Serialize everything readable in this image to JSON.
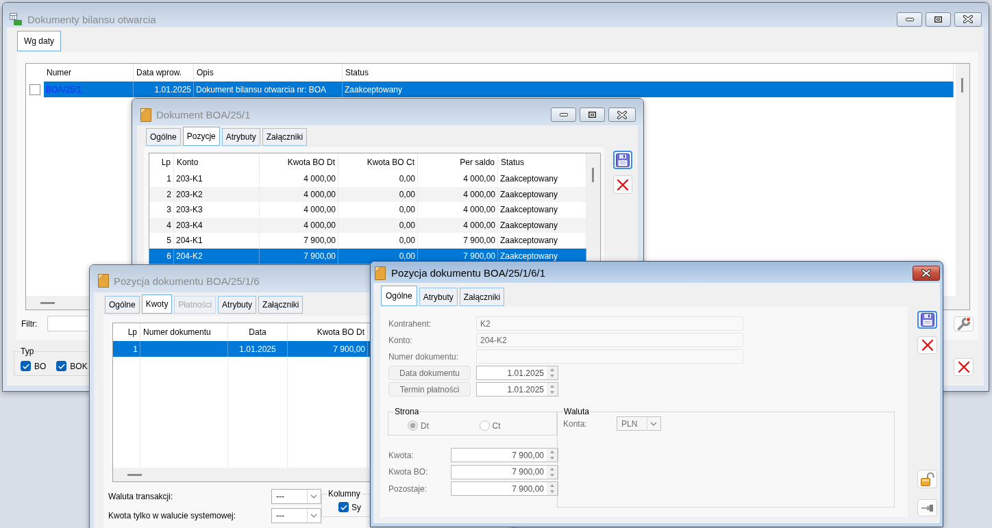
{
  "main_window": {
    "title": "Dokumenty bilansu otwarcia",
    "active": false,
    "tabs": [
      {
        "label": "Wg daty",
        "selected": true
      }
    ],
    "table": {
      "columns": [
        "Numer",
        "Data wprow.",
        "Opis",
        "Status"
      ],
      "rows": [
        {
          "checked": false,
          "selected": true,
          "cells": [
            "BOA/25/1",
            "1.01.2025",
            "Dokument bilansu otwarcia nr: BOA",
            "Zaakceptowany"
          ]
        }
      ]
    },
    "filter": {
      "label": "Filtr:"
    },
    "type_group": {
      "title": "Typ",
      "options": [
        {
          "label": "BO",
          "checked": true
        },
        {
          "label": "BOK",
          "checked": true
        }
      ]
    }
  },
  "document_window": {
    "title": "Dokument BOA/25/1",
    "active": false,
    "tabs": [
      {
        "label": "Ogólne",
        "selected": false
      },
      {
        "label": "Pozycje",
        "selected": true
      },
      {
        "label": "Atrybuty",
        "selected": false
      },
      {
        "label": "Załączniki",
        "selected": false
      }
    ],
    "table": {
      "columns": [
        "Lp",
        "Konto",
        "Kwota BO Dt",
        "Kwota BO Ct",
        "Per saldo",
        "Status"
      ],
      "rows": [
        {
          "selected": false,
          "cells": [
            "1",
            "203-K1",
            "4 000,00",
            "0,00",
            "4 000,00",
            "Zaakceptowany"
          ]
        },
        {
          "selected": false,
          "cells": [
            "2",
            "203-K2",
            "4 000,00",
            "0,00",
            "4 000,00",
            "Zaakceptowany"
          ]
        },
        {
          "selected": false,
          "cells": [
            "3",
            "203-K3",
            "4 000,00",
            "0,00",
            "4 000,00",
            "Zaakceptowany"
          ]
        },
        {
          "selected": false,
          "cells": [
            "4",
            "203-K4",
            "4 000,00",
            "0,00",
            "4 000,00",
            "Zaakceptowany"
          ]
        },
        {
          "selected": false,
          "cells": [
            "5",
            "204-K1",
            "7 900,00",
            "0,00",
            "7 900,00",
            "Zaakceptowany"
          ]
        },
        {
          "selected": true,
          "cells": [
            "6",
            "204-K2",
            "7 900,00",
            "0,00",
            "7 900,00",
            "Zaakceptowany"
          ]
        }
      ]
    }
  },
  "position_window": {
    "title": "Pozycja dokumentu BOA/25/1/6",
    "active": false,
    "tabs": [
      {
        "label": "Ogólne",
        "selected": false,
        "disabled": false
      },
      {
        "label": "Kwoty",
        "selected": true,
        "disabled": false
      },
      {
        "label": "Płatności",
        "selected": false,
        "disabled": true
      },
      {
        "label": "Atrybuty",
        "selected": false,
        "disabled": false
      },
      {
        "label": "Załączniki",
        "selected": false,
        "disabled": false
      }
    ],
    "table": {
      "columns": [
        "Lp",
        "Numer dokumentu",
        "Data",
        "Kwota BO Dt"
      ],
      "rows": [
        {
          "selected": true,
          "lp": "1",
          "date": "1.01.2025",
          "amount_dt": "7 900,00"
        }
      ]
    },
    "selects": [
      {
        "label": "Waluta transakcji:",
        "value": "---"
      },
      {
        "label": "Kwota tylko w walucie systemowej:",
        "value": "---"
      }
    ],
    "columns_group": {
      "title": "Kolumny",
      "options": [
        {
          "label": "Sy",
          "checked": true
        }
      ]
    }
  },
  "item_window": {
    "title": "Pozycja dokumentu BOA/25/1/6/1",
    "active": true,
    "tabs": [
      {
        "label": "Ogólne",
        "selected": true
      },
      {
        "label": "Atrybuty",
        "selected": false
      },
      {
        "label": "Załączniki",
        "selected": false
      }
    ],
    "text_fields": [
      {
        "label": "Kontrahent:",
        "value": "K2",
        "disabled": true
      },
      {
        "label": "Konto:",
        "value": "204-K2",
        "disabled": true
      },
      {
        "label": "Numer dokumentu:",
        "disabled": true
      }
    ],
    "date_fields": [
      {
        "label": "Data dokumentu",
        "value": "1.01.2025"
      },
      {
        "label": "Termin płatności",
        "value": "1.01.2025"
      }
    ],
    "side_group": {
      "title": "Strona",
      "options": [
        {
          "label": "Dt",
          "selected": true,
          "disabled": true
        },
        {
          "label": "Ct",
          "selected": false,
          "disabled": true
        }
      ]
    },
    "amount_fields": [
      {
        "label": "Kwota:",
        "value": "7 900,00"
      },
      {
        "label": "Kwota BO:",
        "value": "7 900,00"
      },
      {
        "label": "Pozostaje:",
        "value": "7 900,00"
      }
    ],
    "currency_group": {
      "title": "Waluta",
      "label": "Konta:",
      "value": "PLN"
    }
  }
}
